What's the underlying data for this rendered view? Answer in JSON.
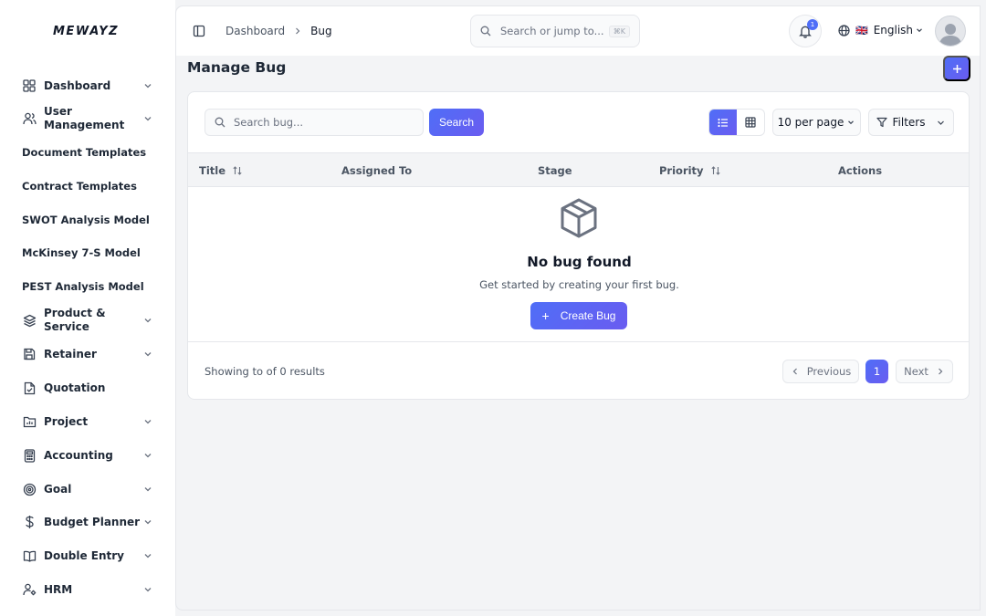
{
  "brand": {
    "logo_text": "MEWAYZ"
  },
  "sidebar": {
    "items": [
      {
        "label": "Dashboard",
        "icon": "dashboard-grid-icon",
        "expandable": true
      },
      {
        "label": "User Management",
        "icon": "users-icon",
        "expandable": true
      },
      {
        "label": "Document Templates",
        "icon": "",
        "expandable": false
      },
      {
        "label": "Contract Templates",
        "icon": "",
        "expandable": false
      },
      {
        "label": "SWOT Analysis Model",
        "icon": "",
        "expandable": false
      },
      {
        "label": "McKinsey 7-S Model",
        "icon": "",
        "expandable": false
      },
      {
        "label": "PEST Analysis Model",
        "icon": "",
        "expandable": false
      },
      {
        "label": "Product & Service",
        "icon": "layers-icon",
        "expandable": true
      },
      {
        "label": "Retainer",
        "icon": "save-icon",
        "expandable": true
      },
      {
        "label": "Quotation",
        "icon": "file-check-icon",
        "expandable": false
      },
      {
        "label": "Project",
        "icon": "folder-chart-icon",
        "expandable": true
      },
      {
        "label": "Accounting",
        "icon": "calculator-icon",
        "expandable": true
      },
      {
        "label": "Goal",
        "icon": "target-icon",
        "expandable": true
      },
      {
        "label": "Budget Planner",
        "icon": "dollar-icon",
        "expandable": true
      },
      {
        "label": "Double Entry",
        "icon": "book-icon",
        "expandable": true
      },
      {
        "label": "HRM",
        "icon": "user-cog-icon",
        "expandable": true
      }
    ]
  },
  "topbar": {
    "breadcrumb": {
      "parent": "Dashboard",
      "current": "Bug"
    },
    "search_placeholder": "Search or jump to...",
    "search_shortcut": "⌘K",
    "notification_count": "1",
    "language": "English",
    "language_flag": "🇬🇧"
  },
  "page": {
    "title": "Manage Bug",
    "search_placeholder": "Search bug...",
    "search_button": "Search",
    "per_page": "10 per page",
    "filters_label": "Filters",
    "columns": [
      "Title",
      "Assigned To",
      "Stage",
      "Priority",
      "Actions"
    ],
    "empty": {
      "title": "No bug found",
      "subtitle": "Get started by creating your first bug.",
      "button": "Create Bug"
    },
    "footer": {
      "results_text": "Showing to of 0 results",
      "prev": "Previous",
      "page": "1",
      "next": "Next"
    }
  },
  "colors": {
    "accent": "#4f6ef7",
    "accent_end": "#6a5cf0"
  }
}
